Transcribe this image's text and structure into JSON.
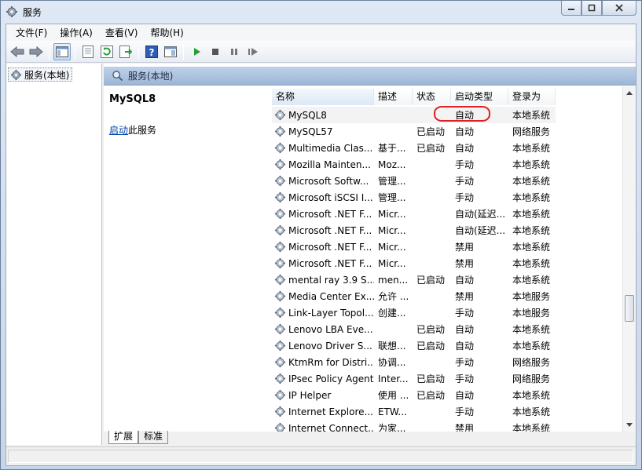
{
  "window": {
    "title": "服务"
  },
  "menu": [
    {
      "label": "文件(F)"
    },
    {
      "label": "操作(A)"
    },
    {
      "label": "查看(V)"
    },
    {
      "label": "帮助(H)"
    }
  ],
  "toolbar": {
    "buttons": [
      "back-icon",
      "forward-icon",
      "show-hide-tree-icon",
      "properties-icon",
      "refresh-icon",
      "export-list-icon",
      "help-icon",
      "console-view-icon",
      "start-service-icon",
      "stop-service-icon",
      "pause-service-icon",
      "restart-service-icon"
    ]
  },
  "tree": {
    "root_label": "服务(本地)"
  },
  "pane_header": {
    "label": "服务(本地)"
  },
  "details": {
    "service_name": "MySQL8",
    "start_link": "启动",
    "start_suffix": "此服务"
  },
  "columns": [
    "名称",
    "描述",
    "状态",
    "启动类型",
    "登录为"
  ],
  "services": [
    {
      "name": "MySQL8",
      "desc": "",
      "state": "",
      "startup": "自动",
      "logon": "本地系统"
    },
    {
      "name": "MySQL57",
      "desc": "",
      "state": "已启动",
      "startup": "自动",
      "logon": "网络服务"
    },
    {
      "name": "Multimedia Clas...",
      "desc": "基于...",
      "state": "已启动",
      "startup": "自动",
      "logon": "本地系统"
    },
    {
      "name": "Mozilla Mainten...",
      "desc": "Moz...",
      "state": "",
      "startup": "手动",
      "logon": "本地系统"
    },
    {
      "name": "Microsoft Softw...",
      "desc": "管理...",
      "state": "",
      "startup": "手动",
      "logon": "本地系统"
    },
    {
      "name": "Microsoft iSCSI I...",
      "desc": "管理...",
      "state": "",
      "startup": "手动",
      "logon": "本地系统"
    },
    {
      "name": "Microsoft .NET F...",
      "desc": "Micr...",
      "state": "",
      "startup": "自动(延迟...",
      "logon": "本地系统"
    },
    {
      "name": "Microsoft .NET F...",
      "desc": "Micr...",
      "state": "",
      "startup": "自动(延迟...",
      "logon": "本地系统"
    },
    {
      "name": "Microsoft .NET F...",
      "desc": "Micr...",
      "state": "",
      "startup": "禁用",
      "logon": "本地系统"
    },
    {
      "name": "Microsoft .NET F...",
      "desc": "Micr...",
      "state": "",
      "startup": "禁用",
      "logon": "本地系统"
    },
    {
      "name": "mental ray 3.9 S...",
      "desc": "men...",
      "state": "已启动",
      "startup": "自动",
      "logon": "本地系统"
    },
    {
      "name": "Media Center Ex...",
      "desc": "允许 ...",
      "state": "",
      "startup": "禁用",
      "logon": "本地服务"
    },
    {
      "name": "Link-Layer Topol...",
      "desc": "创建...",
      "state": "",
      "startup": "手动",
      "logon": "本地服务"
    },
    {
      "name": "Lenovo LBA Eve...",
      "desc": "",
      "state": "已启动",
      "startup": "自动",
      "logon": "本地系统"
    },
    {
      "name": "Lenovo Driver S...",
      "desc": "联想...",
      "state": "已启动",
      "startup": "自动",
      "logon": "本地系统"
    },
    {
      "name": "KtmRm for Distri...",
      "desc": "协调...",
      "state": "",
      "startup": "手动",
      "logon": "网络服务"
    },
    {
      "name": "IPsec Policy Agent",
      "desc": "Inter...",
      "state": "已启动",
      "startup": "手动",
      "logon": "网络服务"
    },
    {
      "name": "IP Helper",
      "desc": "使用 ...",
      "state": "已启动",
      "startup": "自动",
      "logon": "本地系统"
    },
    {
      "name": "Internet Explore...",
      "desc": "ETW...",
      "state": "",
      "startup": "手动",
      "logon": "本地系统"
    },
    {
      "name": "Internet Connect...",
      "desc": "为家...",
      "state": "",
      "startup": "禁用",
      "logon": "本地系统"
    }
  ],
  "tabs": [
    {
      "label": "扩展"
    },
    {
      "label": "标准"
    }
  ],
  "colors": {
    "accent": "#9db6d6",
    "annotation": "#e02020",
    "link": "#0645ad"
  }
}
